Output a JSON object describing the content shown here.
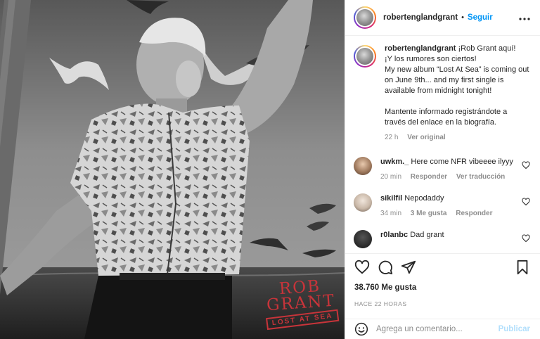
{
  "post": {
    "username": "robertenglandgrant",
    "separator": "•",
    "follow_label": "Seguir",
    "more_label": "•••"
  },
  "album": {
    "line1": "ROB",
    "line2": "GRANT",
    "subtitle": "LOST AT SEA"
  },
  "caption": {
    "username": "robertenglandgrant",
    "text_lines": [
      "¡Rob Grant aquí!",
      "¡Y los rumores son ciertos!",
      "My new album “Lost At Sea” is coming out on June 9th... and my first single is available from midnight tonight!",
      "",
      "Mantente informado registrándote a través del enlace en la biografía."
    ],
    "time": "22 h",
    "see_original": "Ver original"
  },
  "comments": [
    {
      "username": "uwkm._",
      "text": "Here come NFR vibeeee ilyyy",
      "time": "20 min",
      "likes": "",
      "reply": "Responder",
      "translate": "Ver traducción",
      "avatar_color": "#a07a5e"
    },
    {
      "username": "sikilfil",
      "text": "Nepodaddy",
      "time": "34 min",
      "likes": "3 Me gusta",
      "reply": "Responder",
      "translate": "",
      "avatar_color": "#c9b8a8"
    },
    {
      "username": "r0lanbc",
      "text": "Dad grant",
      "time": "",
      "likes": "",
      "reply": "",
      "translate": "",
      "avatar_color": "#2e2e2e"
    }
  ],
  "actions": {
    "like_icon": "heart-icon",
    "comment_icon": "comment-icon",
    "share_icon": "share-icon",
    "save_icon": "bookmark-icon"
  },
  "likes_text": "38.760 Me gusta",
  "posted_ago": "HACE 22 HORAS",
  "add_comment": {
    "placeholder": "Agrega un comentario...",
    "publish_label": "Publicar"
  },
  "colors": {
    "accent": "#0095f6",
    "publish_disabled": "#b2dffc",
    "album_red": "#c8343a"
  }
}
